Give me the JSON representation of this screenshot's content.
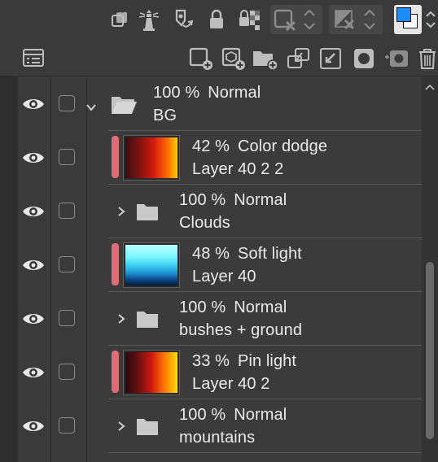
{
  "toolbar_top": {
    "icons": [
      "layer-select-icon",
      "lighthouse-icon",
      "reference-layer-icon",
      "lock-icon",
      "lock-transparency-icon",
      "clip-icon",
      "draft-icon",
      "color-swatch-icon"
    ]
  },
  "toolbar_bottom": {
    "icons": [
      "layer-list-icon",
      "new-raster-layer-icon",
      "new-vector-layer-icon",
      "new-folder-icon",
      "transfer-down-icon",
      "combine-down-icon",
      "mask-icon",
      "mask-apply-icon",
      "delete-icon"
    ]
  },
  "layers": [
    {
      "kind": "folder",
      "expanded": true,
      "opacity": "100 %",
      "mode": "Normal",
      "name": "BG",
      "marker": false
    },
    {
      "kind": "raster",
      "opacity": "42 %",
      "mode": "Color dodge",
      "name": "Layer 40 2 2",
      "marker": true,
      "thumb": "fire"
    },
    {
      "kind": "folder",
      "expanded": false,
      "opacity": "100 %",
      "mode": "Normal",
      "name": "Clouds",
      "marker": false
    },
    {
      "kind": "raster",
      "opacity": "48 %",
      "mode": "Soft light",
      "name": "Layer 40",
      "marker": true,
      "thumb": "sky"
    },
    {
      "kind": "folder",
      "expanded": false,
      "opacity": "100 %",
      "mode": "Normal",
      "name": "bushes + ground",
      "marker": false
    },
    {
      "kind": "raster",
      "opacity": "33 %",
      "mode": "Pin light",
      "name": "Layer 40 2",
      "marker": true,
      "thumb": "fire2"
    },
    {
      "kind": "folder",
      "expanded": false,
      "opacity": "100 %",
      "mode": "Normal",
      "name": "mountains",
      "marker": false
    }
  ],
  "colors": {
    "marker": "#e36a72",
    "accent_front": "#1a8cff"
  }
}
